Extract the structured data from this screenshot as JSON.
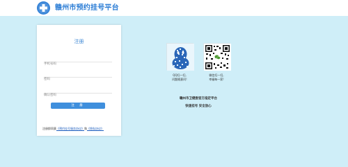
{
  "header": {
    "site_title": "赣州市预约挂号平台",
    "logo_icon": "medical-cross-icon",
    "logo_color": "#2f7fd6"
  },
  "register_form": {
    "title": "注册",
    "phone_placeholder": "手机号码",
    "password_placeholder": "密码",
    "confirm_password_placeholder": "确认密码",
    "submit_label": "注 册",
    "agreement_prefix": "注册即同意",
    "agreement_link1": "《预约挂号服务协议》",
    "agreement_and": "和",
    "agreement_link2": "《隐私协议》",
    "accent_color": "#3f8fdd"
  },
  "qq_block": {
    "icon": "qq-penguin-qr-icon",
    "line1": "QQ扫一扫,",
    "line2": "问题随意问!"
  },
  "wechat_block": {
    "icon": "wechat-qr-code-icon",
    "line1": "微信扫一扫,",
    "line2": "幸福每一家!"
  },
  "slogan": {
    "line1": "赣州市卫健委官方指定平台",
    "line2": "快速挂号 安全放心"
  },
  "background_color": "#cfeef8"
}
